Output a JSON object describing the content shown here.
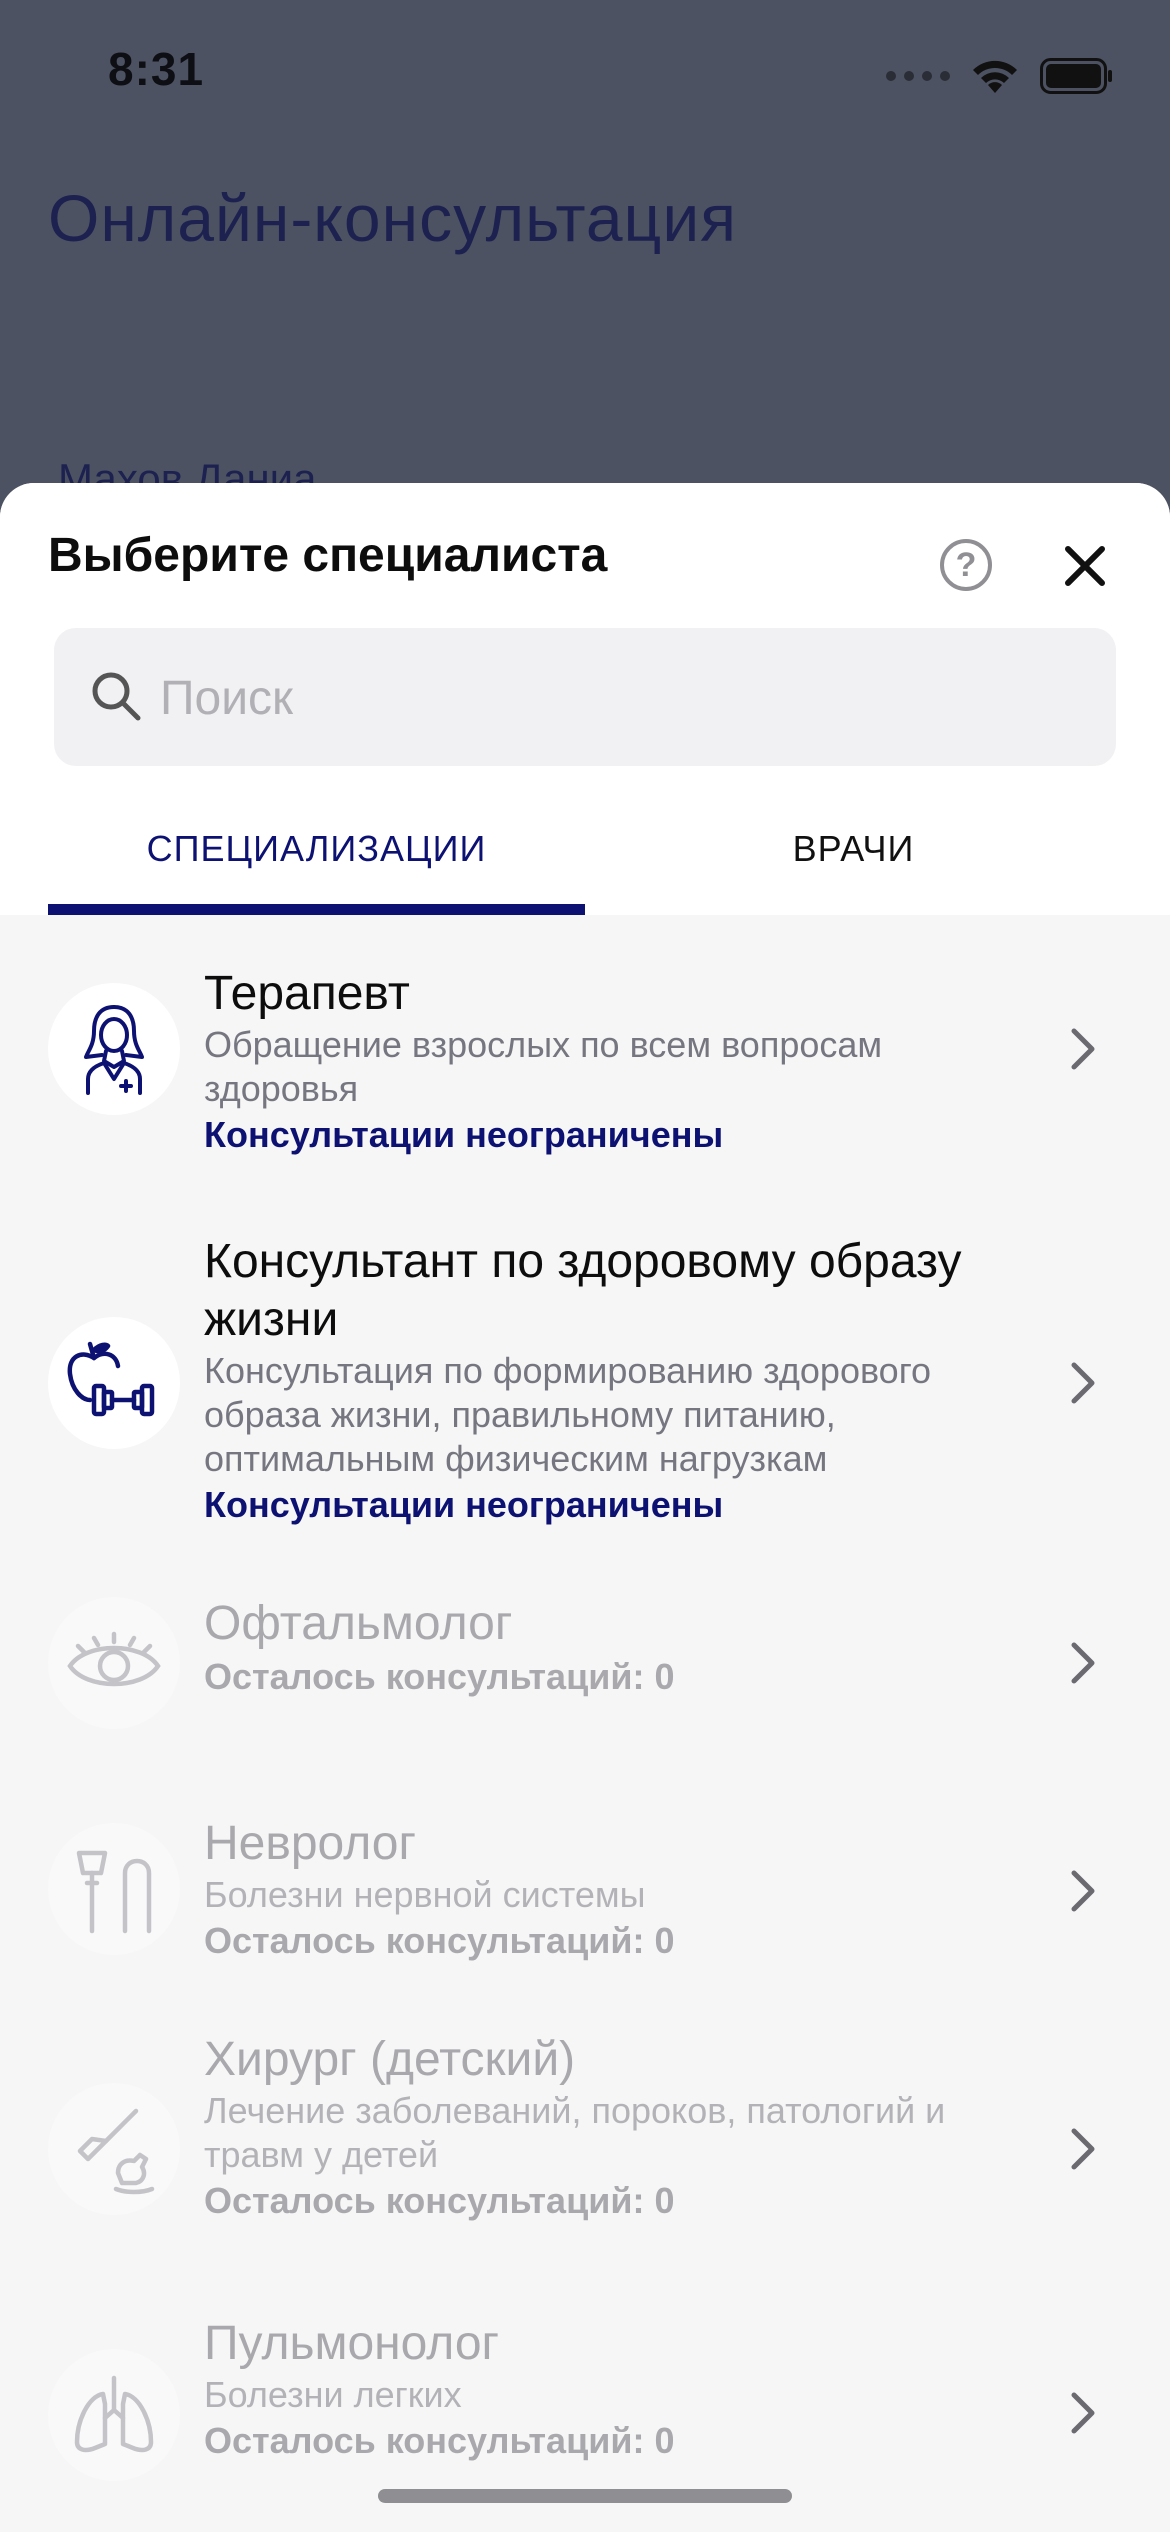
{
  "status_bar": {
    "time": "8:31"
  },
  "background": {
    "title": "Онлайн-консультация",
    "name_partial": "Махов Даниа"
  },
  "sheet": {
    "title": "Выберите специалиста",
    "help_label": "?",
    "search": {
      "placeholder": "Поиск",
      "value": ""
    },
    "tabs": [
      {
        "label": "СПЕЦИАЛИЗАЦИИ",
        "active": true
      },
      {
        "label": "ВРАЧИ",
        "active": false
      }
    ],
    "items": [
      {
        "title": "Терапевт",
        "desc": "Обращение взрослых по всем вопросам здоровья",
        "quota": "Консультации неограничены",
        "icon": "doctor-icon",
        "enabled": true
      },
      {
        "title": "Консультант по здоровому образу жизни",
        "desc": "Консультация по формированию здорового образа жизни, правильному питанию, оптимальным физическим нагрузкам",
        "quota": "Консультации неограничены",
        "icon": "apple-dumbbell-icon",
        "enabled": true
      },
      {
        "title": "Офтальмолог",
        "desc": "",
        "quota": "Осталось консультаций: 0",
        "icon": "eye-icon",
        "enabled": false
      },
      {
        "title": "Невролог",
        "desc": "Болезни нервной системы",
        "quota": "Осталось консультаций: 0",
        "icon": "reflex-hammer-icon",
        "enabled": false
      },
      {
        "title": "Хирург (детский)",
        "desc": "Лечение заболеваний, пороков, патологий и травм у детей",
        "quota": "Осталось консультаций: 0",
        "icon": "scalpel-horse-icon",
        "enabled": false
      },
      {
        "title": "Пульмонолог",
        "desc": "Болезни легких",
        "quota": "Осталось консультаций: 0",
        "icon": "lungs-icon",
        "enabled": false
      }
    ]
  },
  "colors": {
    "accent": "#0d1272",
    "overlay": "#4c5262",
    "disabled": "#a9a9ad"
  }
}
